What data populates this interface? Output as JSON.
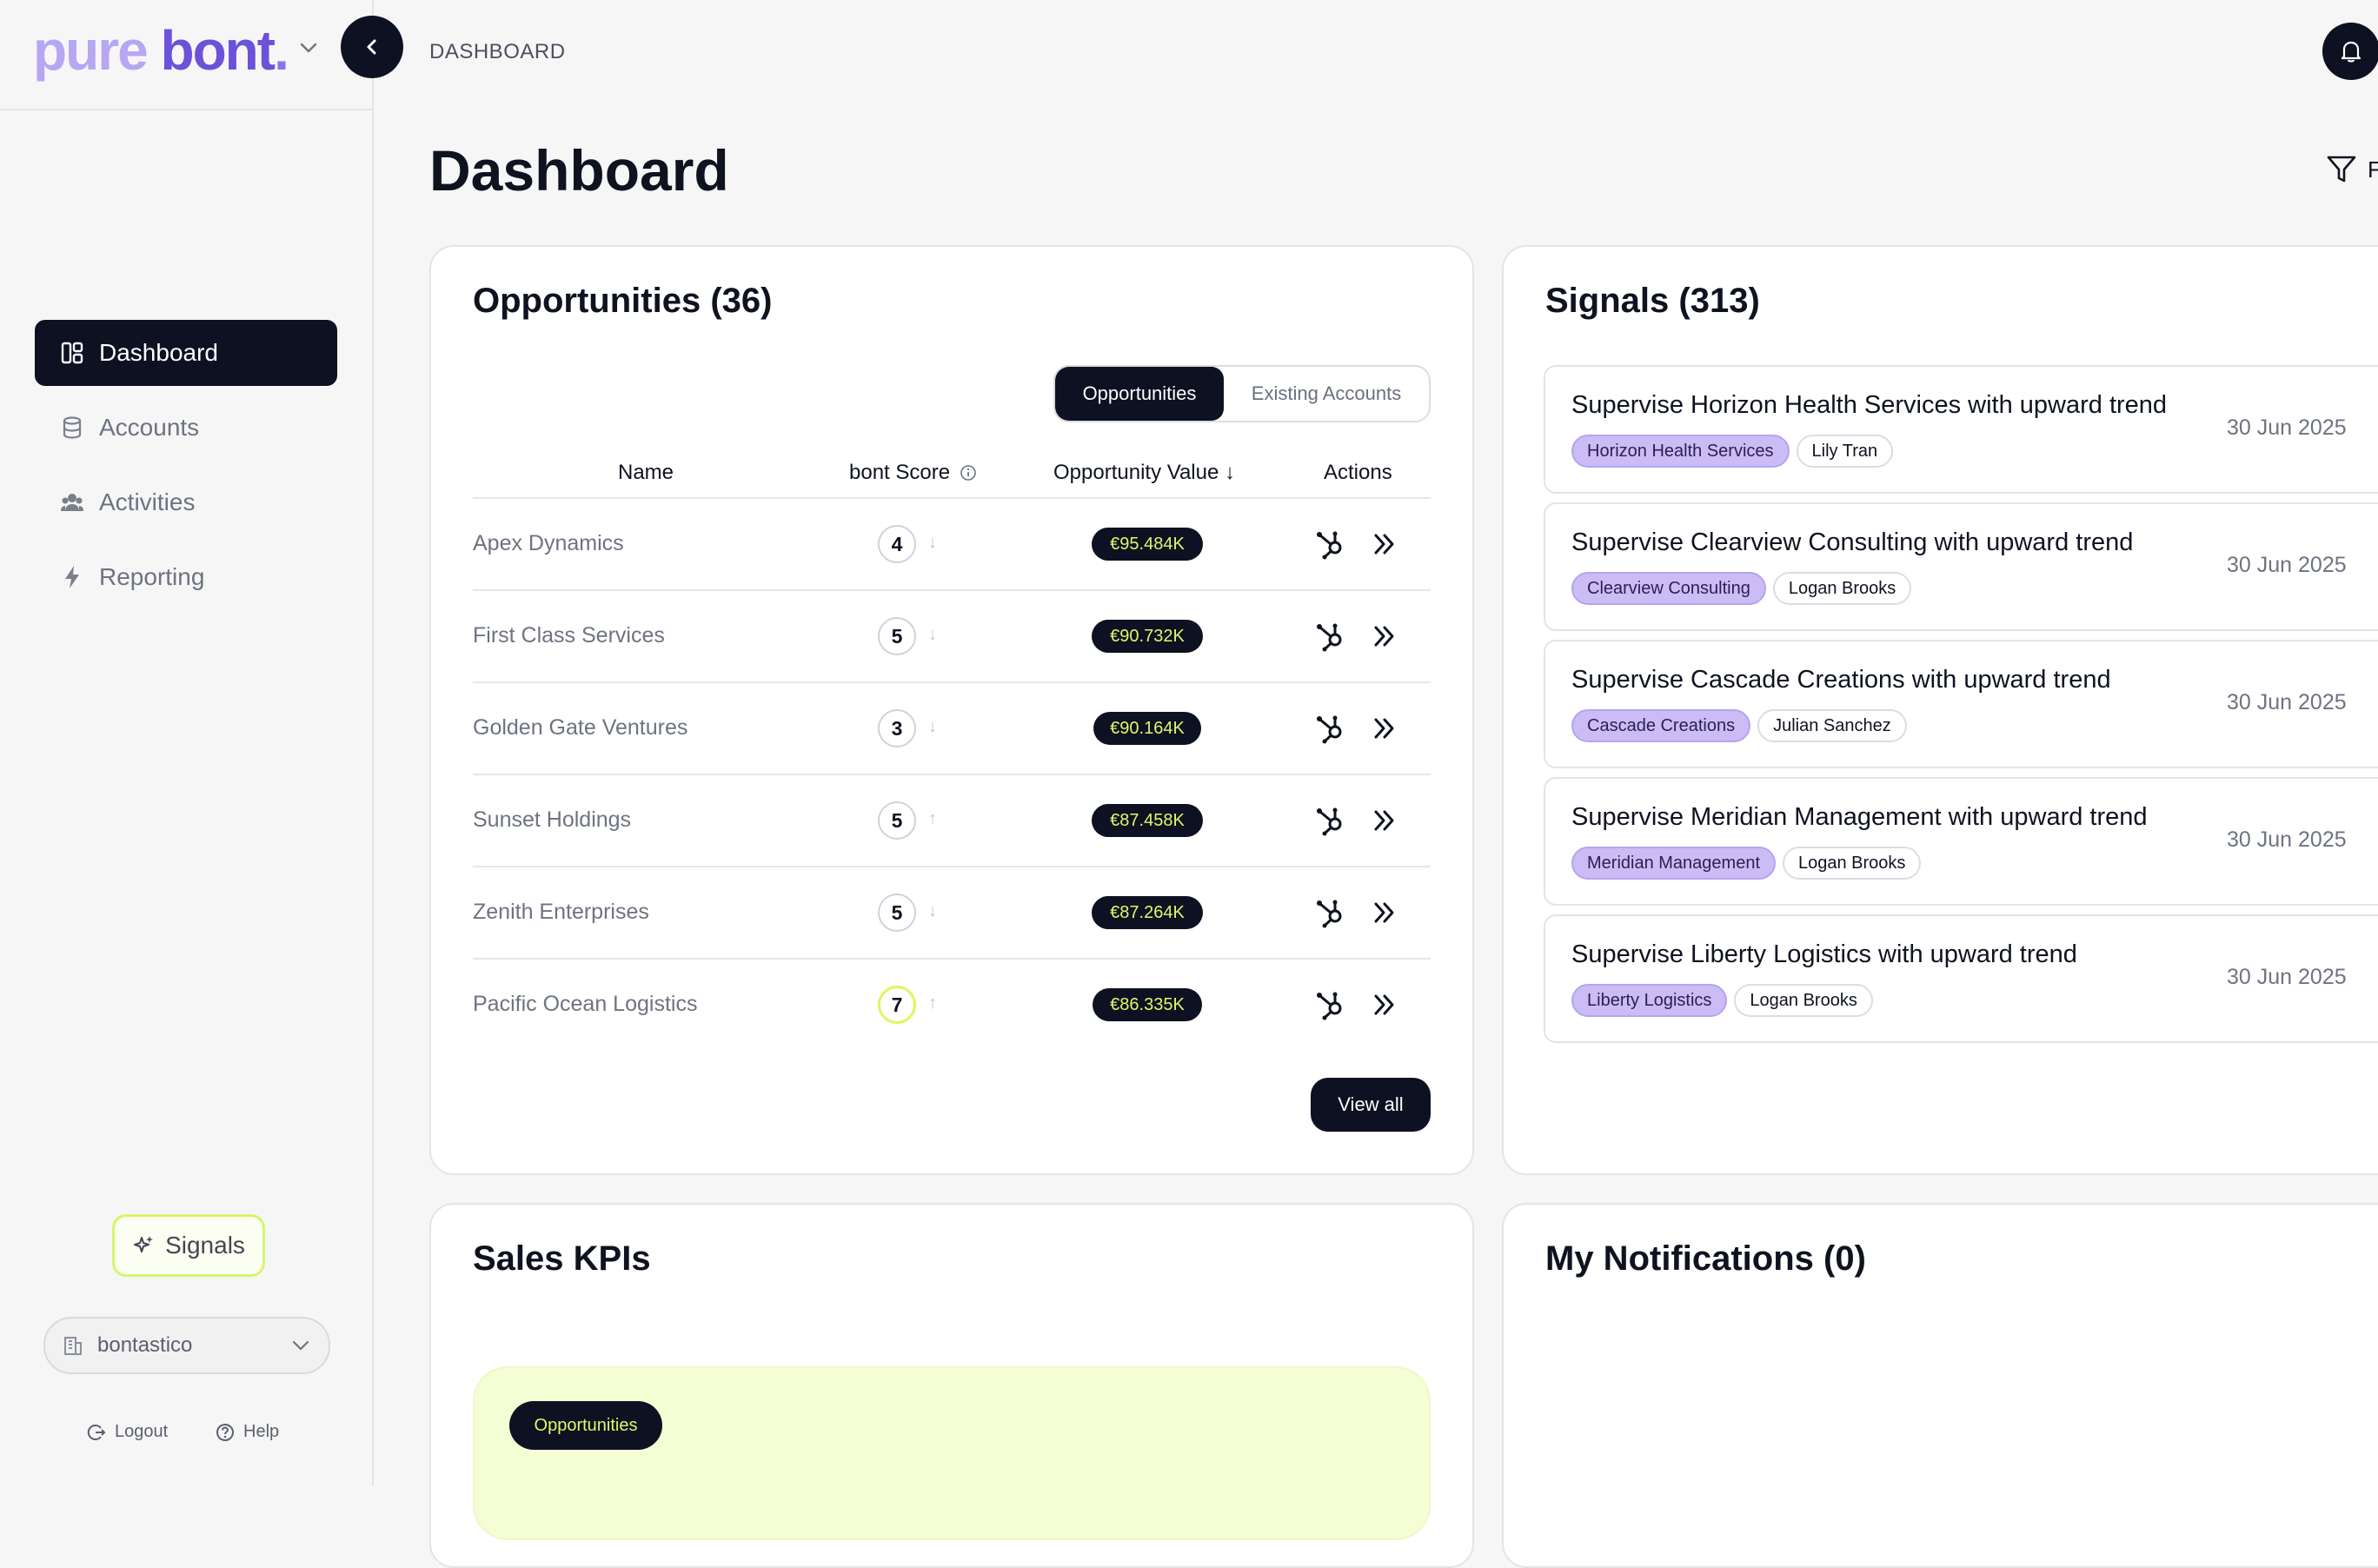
{
  "app": {
    "logo_pure": "pure",
    "logo_bont": "bont",
    "logo_dot": ".",
    "breadcrumb": "DASHBOARD",
    "page_title": "Dashboard",
    "filter_label_partial": "F"
  },
  "sidebar": {
    "items": [
      {
        "label": "Dashboard",
        "icon": "dashboard-icon",
        "active": true
      },
      {
        "label": "Accounts",
        "icon": "database-icon",
        "active": false
      },
      {
        "label": "Activities",
        "icon": "users-icon",
        "active": false
      },
      {
        "label": "Reporting",
        "icon": "bolt-icon",
        "active": false
      }
    ],
    "signals_button": "Signals",
    "org_select": "bontastico",
    "logout": "Logout",
    "help": "Help"
  },
  "opportunities": {
    "title": "Opportunities (36)",
    "tabs": [
      "Opportunities",
      "Existing Accounts"
    ],
    "columns": [
      "Name",
      "bont Score",
      "Opportunity Value ↓",
      "Actions"
    ],
    "rows": [
      {
        "name": "Apex Dynamics",
        "score": "4",
        "trend": "↓",
        "value": "€95.484K"
      },
      {
        "name": "First Class Services",
        "score": "5",
        "trend": "↓",
        "value": "€90.732K"
      },
      {
        "name": "Golden Gate Ventures",
        "score": "3",
        "trend": "↓",
        "value": "€90.164K"
      },
      {
        "name": "Sunset Holdings",
        "score": "5",
        "trend": "↑",
        "value": "€87.458K"
      },
      {
        "name": "Zenith Enterprises",
        "score": "5",
        "trend": "↓",
        "value": "€87.264K"
      },
      {
        "name": "Pacific Ocean Logistics",
        "score": "7",
        "trend": "↑",
        "value": "€86.335K"
      }
    ],
    "view_all": "View all"
  },
  "signals": {
    "title": "Signals (313)",
    "items": [
      {
        "title": "Supervise Horizon Health Services with upward trend",
        "company": "Horizon Health Services",
        "person": "Lily Tran",
        "date": "30 Jun 2025"
      },
      {
        "title": "Supervise Clearview Consulting with upward trend",
        "company": "Clearview Consulting",
        "person": "Logan Brooks",
        "date": "30 Jun 2025"
      },
      {
        "title": "Supervise Cascade Creations with upward trend",
        "company": "Cascade Creations",
        "person": "Julian Sanchez",
        "date": "30 Jun 2025"
      },
      {
        "title": "Supervise Meridian Management with upward trend",
        "company": "Meridian Management",
        "person": "Logan Brooks",
        "date": "30 Jun 2025"
      },
      {
        "title": "Supervise Liberty Logistics with upward trend",
        "company": "Liberty Logistics",
        "person": "Logan Brooks",
        "date": "30 Jun 2025"
      }
    ]
  },
  "sales_kpis": {
    "title": "Sales KPIs",
    "tab": "Opportunities"
  },
  "notifications": {
    "title": "My Notifications (0)"
  },
  "colors": {
    "dark": "#0d1122",
    "accent_lime": "#e0f66a",
    "brand_purple": "#6b52d9",
    "tag_purple": "#cbbcf5"
  }
}
